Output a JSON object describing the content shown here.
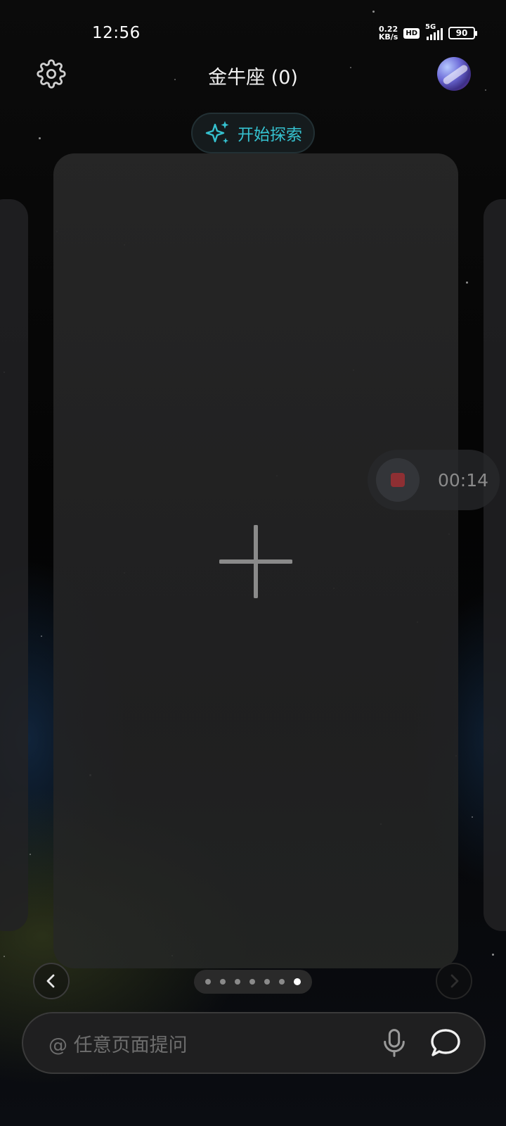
{
  "status_bar": {
    "time": "12:56",
    "net_speed": "0.22",
    "net_unit": "KB/s",
    "hd": "HD",
    "network": "5G",
    "battery": "90"
  },
  "header": {
    "title": "金牛座 (0)",
    "settings_icon": "gear-icon",
    "avatar_icon": "avatar-image"
  },
  "explore": {
    "label": "开始探索",
    "icon": "sparkle-icon",
    "color": "#35c1cf"
  },
  "card": {
    "add_icon": "plus-icon"
  },
  "recording": {
    "time": "00:14",
    "stop_color": "#8e2f33"
  },
  "pager": {
    "total": 7,
    "active_index": 6
  },
  "input": {
    "placeholder": "@ 任意页面提问",
    "mic_icon": "microphone-icon",
    "chat_icon": "chat-bubble-icon"
  }
}
